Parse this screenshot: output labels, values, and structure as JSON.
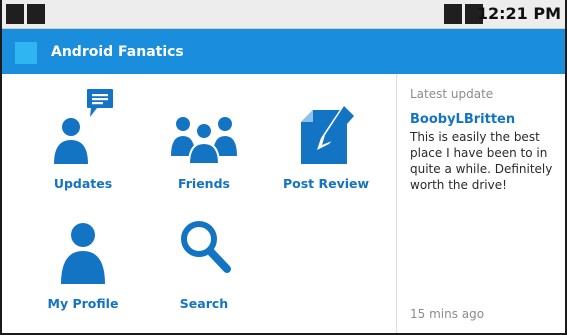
{
  "status_bar": {
    "time": "12:21 PM",
    "left_icons": [
      "notification-icon",
      "notification-icon"
    ],
    "right_icons": [
      "wifi-icon",
      "signal-icon"
    ]
  },
  "app_bar": {
    "title": "Android Fanatics",
    "icon": "app-logo-icon"
  },
  "dashboard": {
    "items": [
      {
        "label": "Updates",
        "icon": "updates-icon"
      },
      {
        "label": "Friends",
        "icon": "friends-icon"
      },
      {
        "label": "Post Review",
        "icon": "post-review-icon"
      },
      {
        "label": "My Profile",
        "icon": "profile-icon"
      },
      {
        "label": "Search",
        "icon": "search-icon"
      }
    ]
  },
  "latest_update": {
    "header": "Latest update",
    "user": "BoobyLBritten",
    "message": "This is easily the best place I have been to in quite a while. Definitely worth the drive!",
    "time_ago": "15 mins ago"
  },
  "colors": {
    "accent": "#1a8ddc",
    "icon_blue": "#1474c4",
    "light_blue": "#2fb6f2",
    "status_bg": "#ededed",
    "text_gray": "#8c8c8c"
  }
}
